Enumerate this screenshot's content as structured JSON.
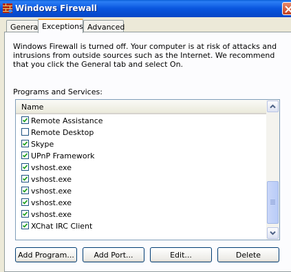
{
  "window": {
    "title": "Windows Firewall"
  },
  "tabs": [
    {
      "label": "General"
    },
    {
      "label": "Exceptions"
    },
    {
      "label": "Advanced"
    }
  ],
  "info_text": "Windows Firewall is turned off. Your computer is at risk of attacks and intrusions from outside sources such as the Internet. We recommend that you click the General tab and select On.",
  "programs": {
    "label": "Programs and Services:",
    "column_name": "Name",
    "items": [
      {
        "label": "Remote Assistance",
        "checked": true
      },
      {
        "label": "Remote Desktop",
        "checked": false
      },
      {
        "label": "Skype",
        "checked": true
      },
      {
        "label": "UPnP Framework",
        "checked": true
      },
      {
        "label": "vshost.exe",
        "checked": true
      },
      {
        "label": "vshost.exe",
        "checked": true
      },
      {
        "label": "vshost.exe",
        "checked": true
      },
      {
        "label": "vshost.exe",
        "checked": true
      },
      {
        "label": "vshost.exe",
        "checked": true
      },
      {
        "label": "XChat IRC Client",
        "checked": true
      }
    ]
  },
  "buttons": {
    "add_program": "Add Program...",
    "add_port": "Add Port...",
    "edit": "Edit...",
    "delete": "Delete"
  },
  "colors": {
    "title_bar": "#0955de",
    "active_tab_accent": "#f7a935",
    "dialog_bg": "#ece9d8"
  }
}
